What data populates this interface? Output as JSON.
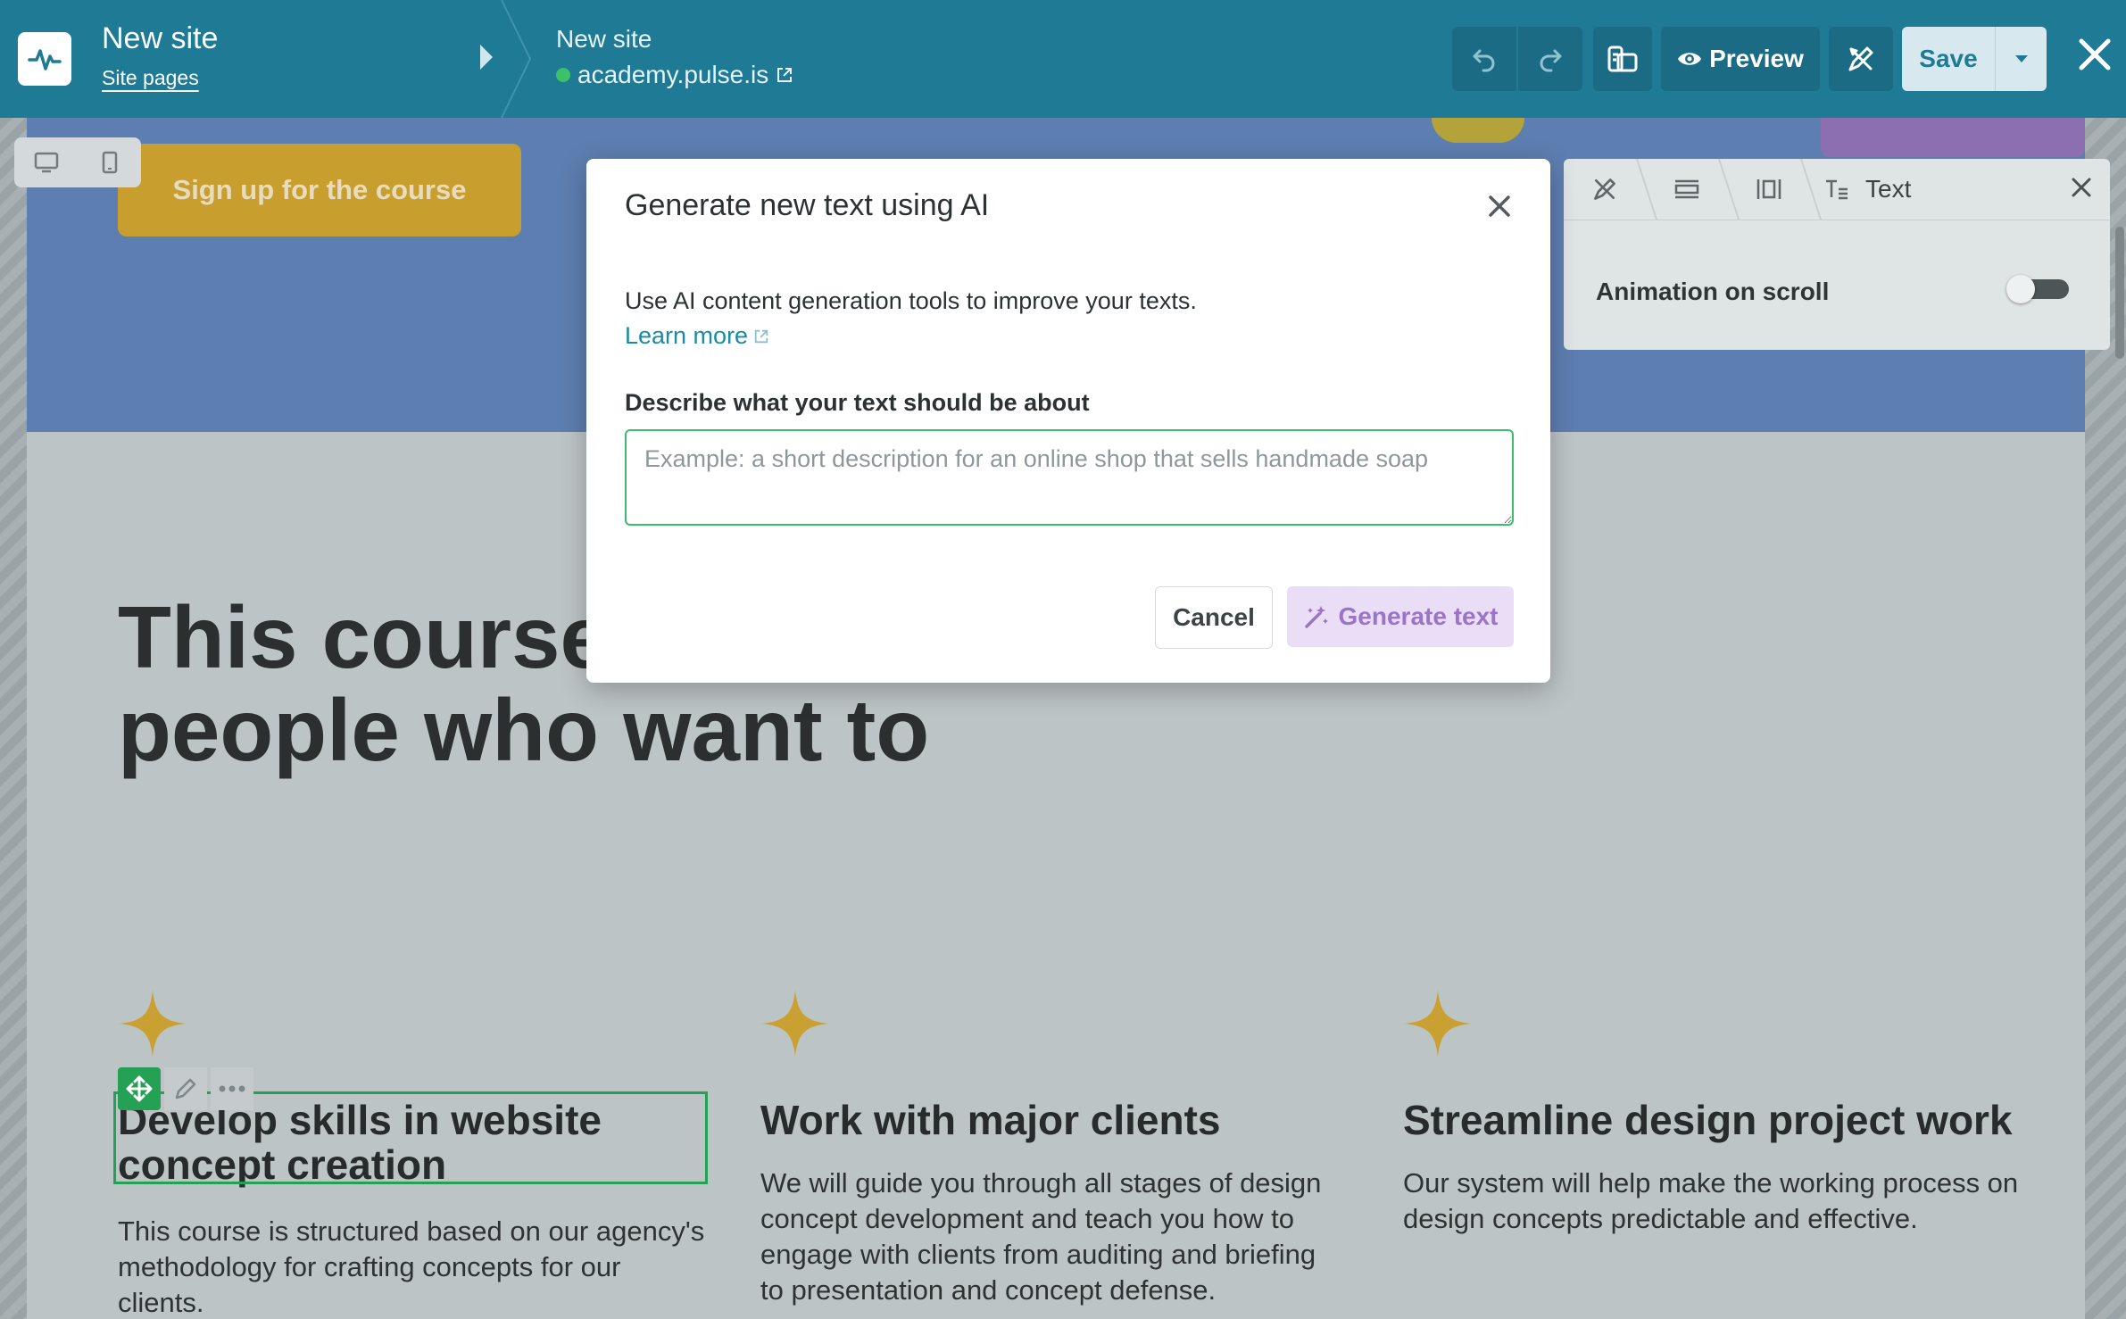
{
  "topbar": {
    "site_title": "New site",
    "site_pages_link": "Site pages",
    "page_name": "New site",
    "page_url": "academy.pulse.is",
    "preview_label": "Preview",
    "save_label": "Save",
    "icons": [
      "pulse-logo-icon",
      "undo-icon",
      "redo-icon",
      "layers-icon",
      "eye-icon",
      "design-tools-icon",
      "chevron-down-icon",
      "close-icon"
    ]
  },
  "canvas": {
    "signup_button": "Sign up for the course",
    "heading_line1": "This course",
    "heading_line2": "people who want to",
    "features": [
      {
        "title": "Develop skills in website concept creation",
        "text": "This course is structured based on our agency's methodology for crafting concepts for our clients."
      },
      {
        "title": "Work with major clients",
        "text": "We will guide you through all stages of design concept development and teach you how to engage with clients from auditing and briefing to presentation and concept defense."
      },
      {
        "title": "Streamline design project work",
        "text": "Our system will help make the working process on design concepts predictable and effective."
      }
    ]
  },
  "properties_panel": {
    "tab_label": "Text",
    "animation_label": "Animation on scroll",
    "animation_enabled": false
  },
  "modal": {
    "title": "Generate new text using AI",
    "description": "Use AI content generation tools to improve your texts.",
    "learn_more": "Learn more",
    "field_label": "Describe what your text should be about",
    "placeholder": "Example: a short description for an online shop that sells handmade soap",
    "value": "",
    "cancel_label": "Cancel",
    "generate_label": "Generate text"
  },
  "colors": {
    "topbar": "#1e7a95",
    "accent_green": "#25a155",
    "generate_purple": "#9b74c8",
    "link_blue": "#1b8aa5"
  }
}
